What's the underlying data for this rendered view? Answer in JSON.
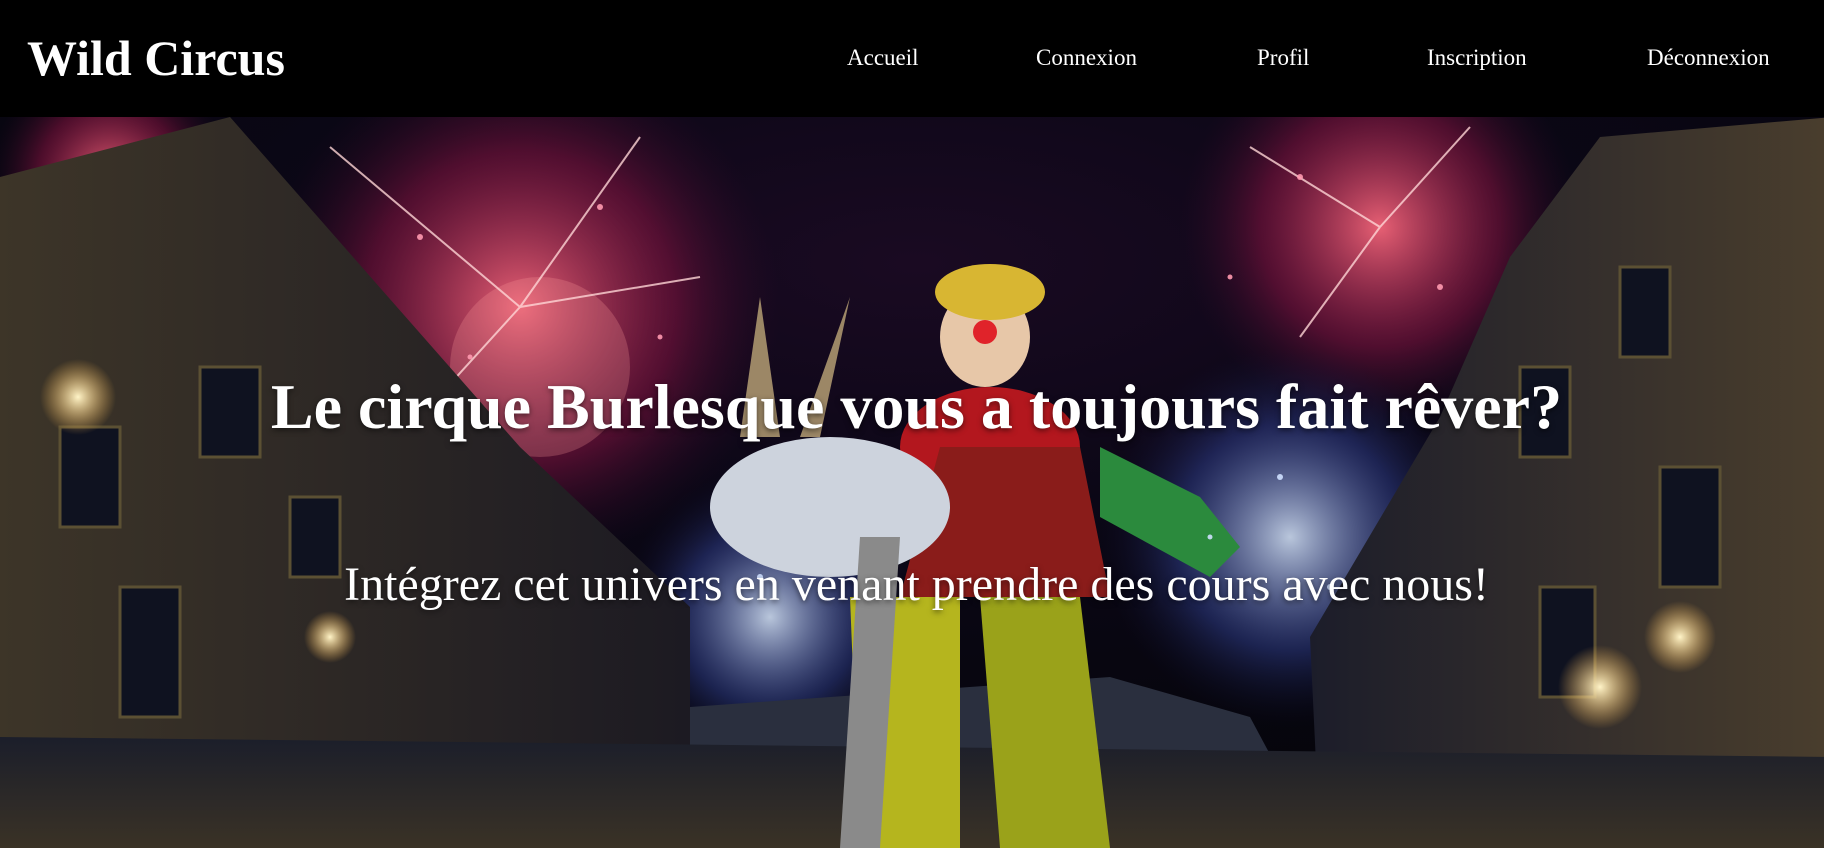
{
  "navbar": {
    "brand": "Wild Circus",
    "links": [
      {
        "label": "Accueil"
      },
      {
        "label": "Connexion"
      },
      {
        "label": "Profil"
      },
      {
        "label": "Inscription"
      },
      {
        "label": "Déconnexion"
      }
    ]
  },
  "hero": {
    "title": "Le cirque Burlesque vous a toujours fait rêver?",
    "subtitle": "Intégrez cet univers en venant prendre des cours avec nous!"
  },
  "colors": {
    "navbar_background": "#000000",
    "text": "#ffffff",
    "night_sky": "#07070f"
  },
  "icons": [
    "fireworks-image",
    "clown-performer-image"
  ]
}
